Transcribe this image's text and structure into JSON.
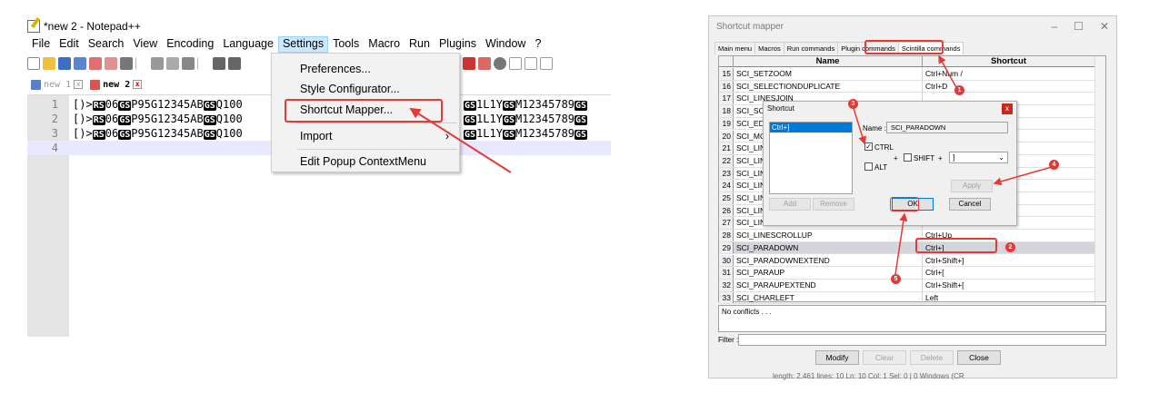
{
  "notepad": {
    "title": "*new 2 - Notepad++",
    "menus": [
      "File",
      "Edit",
      "Search",
      "View",
      "Encoding",
      "Language",
      "Settings",
      "Tools",
      "Macro",
      "Run",
      "Plugins",
      "Window",
      "?"
    ],
    "tabs": [
      {
        "label": "new 1",
        "active": false
      },
      {
        "label": "new 2",
        "active": true
      }
    ],
    "lines": [
      {
        "num": "1",
        "pre": "[)>",
        "rs": "RS",
        "mid": "06",
        "gs": "GS",
        "tail": "P95G12345AB",
        "gs2": "GS",
        "tail2": "Q100",
        "right": "1L1Y",
        "right_gs": "GS",
        "right2": "M12345789",
        "right_gs2": "GS",
        "left_gs": "GS"
      },
      {
        "num": "2",
        "pre": "[)>",
        "rs": "RS",
        "mid": "06",
        "gs": "GS",
        "tail": "P95G12345AB",
        "gs2": "GS",
        "tail2": "Q100",
        "right": "1L1Y",
        "right_gs": "GS",
        "right2": "M12345789",
        "right_gs2": "GS",
        "left_gs": "GS"
      },
      {
        "num": "3",
        "pre": "[)>",
        "rs": "RS",
        "mid": "06",
        "gs": "GS",
        "tail": "P95G12345AB",
        "gs2": "GS",
        "tail2": "Q100",
        "right": "1L1Y",
        "right_gs": "GS",
        "right2": "M12345789",
        "right_gs2": "GS",
        "left_gs": "GS"
      },
      {
        "num": "4"
      }
    ],
    "settings_menu": {
      "preferences": "Preferences...",
      "style_configurator": "Style Configurator...",
      "shortcut_mapper": "Shortcut Mapper...",
      "import": "Import",
      "edit_popup": "Edit Popup ContextMenu",
      "submenu_arrow": "›"
    }
  },
  "mapper": {
    "title": "Shortcut mapper",
    "window_buttons": [
      "–",
      "☐",
      "✕"
    ],
    "tabs": [
      "Main menu",
      "Macros",
      "Run commands",
      "Plugin commands",
      "Scintilla commands"
    ],
    "active_tab": "Scintilla commands",
    "columns": {
      "name": "Name",
      "shortcut": "Shortcut"
    },
    "rows": [
      {
        "num": "15",
        "name": "SCI_SETZOOM",
        "shortcut": "Ctrl+Num /"
      },
      {
        "num": "16",
        "name": "SCI_SELECTIONDUPLICATE",
        "shortcut": "Ctrl+D"
      },
      {
        "num": "17",
        "name": "SCI_LINESJOIN",
        "shortcut": ""
      },
      {
        "num": "18",
        "name": "SCI_SCI",
        "shortcut": ""
      },
      {
        "num": "19",
        "name": "SCI_EDI",
        "shortcut": ""
      },
      {
        "num": "20",
        "name": "SCI_MO",
        "shortcut": ""
      },
      {
        "num": "21",
        "name": "SCI_LIN",
        "shortcut": ""
      },
      {
        "num": "22",
        "name": "SCI_LIN",
        "shortcut": ""
      },
      {
        "num": "23",
        "name": "SCI_LIN",
        "shortcut": ""
      },
      {
        "num": "24",
        "name": "SCI_LIN",
        "shortcut": ""
      },
      {
        "num": "25",
        "name": "SCI_LIN",
        "shortcut": ""
      },
      {
        "num": "26",
        "name": "SCI_LIN",
        "shortcut": ""
      },
      {
        "num": "27",
        "name": "SCI_LIN",
        "shortcut": ""
      },
      {
        "num": "28",
        "name": "SCI_LINESCROLLUP",
        "shortcut": "Ctrl+Up"
      },
      {
        "num": "29",
        "name": "SCI_PARADOWN",
        "shortcut": "Ctrl+]",
        "selected": true
      },
      {
        "num": "30",
        "name": "SCI_PARADOWNEXTEND",
        "shortcut": "Ctrl+Shift+]"
      },
      {
        "num": "31",
        "name": "SCI_PARAUP",
        "shortcut": "Ctrl+["
      },
      {
        "num": "32",
        "name": "SCI_PARAUPEXTEND",
        "shortcut": "Ctrl+Shift+["
      },
      {
        "num": "33",
        "name": "SCI_CHARLEFT",
        "shortcut": "Left"
      }
    ],
    "conflicts": "No conflicts . . .",
    "filter_label": "Filter :",
    "buttons": {
      "modify": "Modify",
      "clear": "Clear",
      "delete": "Delete",
      "close": "Close"
    },
    "status": "length: 2,461   lines: 10   Ln: 10   Col: 1   Sel: 0 | 0   Windows (CR"
  },
  "shortcut_dialog": {
    "title": "Shortcut",
    "close": "x",
    "list_item": "Ctrl+]",
    "name_label": "Name :",
    "name_value": "SCI_PARADOWN",
    "ctrl_label": "CTRL",
    "alt_label": "ALT",
    "plus": "+",
    "shift_label": "SHIFT",
    "key_value": "]",
    "buttons": {
      "add": "Add",
      "remove": "Remove",
      "apply": "Apply",
      "ok": "OK",
      "cancel": "Cancel"
    },
    "ctrl_checked": true,
    "alt_checked": false,
    "shift_checked": false
  },
  "annotations": [
    "1",
    "2",
    "3",
    "4",
    "5"
  ],
  "colors": {
    "highlight": "#e53935",
    "selection": "#0078d7",
    "menu_active": "#cce8ff"
  }
}
